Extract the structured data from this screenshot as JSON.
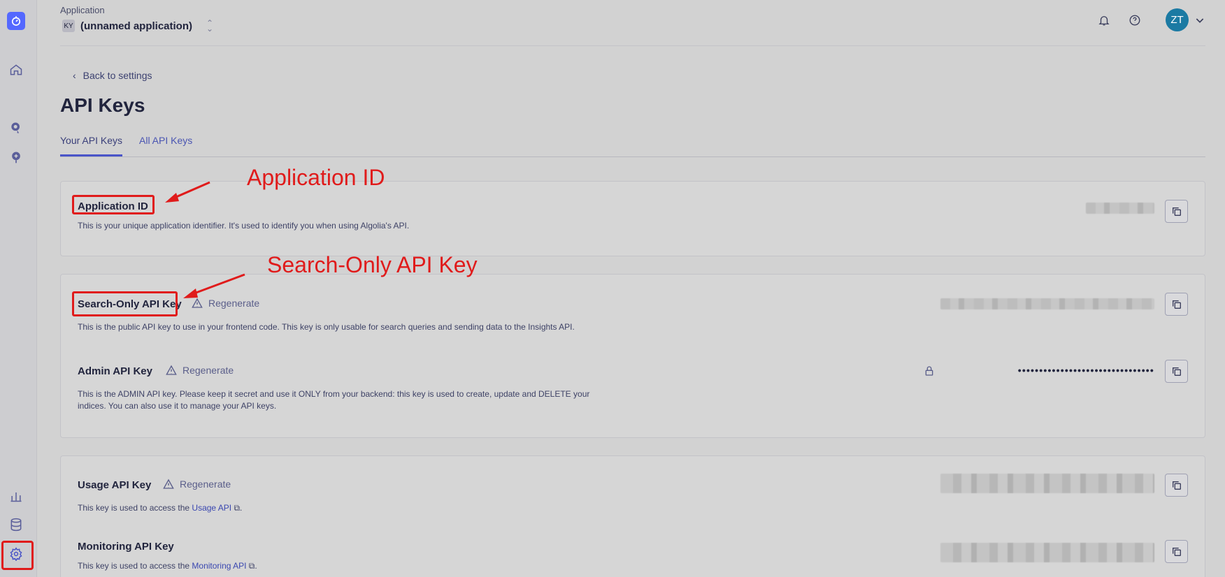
{
  "topbar": {
    "app_label": "Application",
    "app_badge": "KY",
    "app_name": "(unnamed application)",
    "avatar_initials": "ZT"
  },
  "page": {
    "back_label": "Back to settings",
    "title": "API Keys",
    "tabs": [
      {
        "label": "Your API Keys",
        "active": true
      },
      {
        "label": "All API Keys",
        "active": false
      }
    ]
  },
  "keys": {
    "application_id": {
      "title": "Application ID",
      "description": "This is your unique application identifier. It's used to identify you when using Algolia's API."
    },
    "search_only": {
      "title": "Search-Only API Key",
      "regenerate": "Regenerate",
      "description": "This is the public API key to use in your frontend code. This key is only usable for search queries and sending data to the Insights API."
    },
    "admin": {
      "title": "Admin API Key",
      "regenerate": "Regenerate",
      "description_line1": "This is the ADMIN API key. Please keep it secret and use it ONLY from your backend: this key is used to create, update and DELETE your",
      "description_line2": "indices. You can also use it to manage your API keys.",
      "masked_value": "••••••••••••••••••••••••••••••••"
    },
    "usage": {
      "title": "Usage API Key",
      "regenerate": "Regenerate",
      "description_prefix": "This key is used to access the ",
      "link": "Usage API",
      "description_suffix": "."
    },
    "monitoring": {
      "title": "Monitoring API Key",
      "description_prefix": "This key is used to access the ",
      "link": "Monitoring API",
      "description_suffix": "."
    }
  },
  "annotations": {
    "application_id": "Application ID",
    "search_only": "Search-Only API Key"
  },
  "colors": {
    "annotation": "#e01b1b",
    "accent": "#5468ff",
    "avatar": "#1b7aa3"
  }
}
